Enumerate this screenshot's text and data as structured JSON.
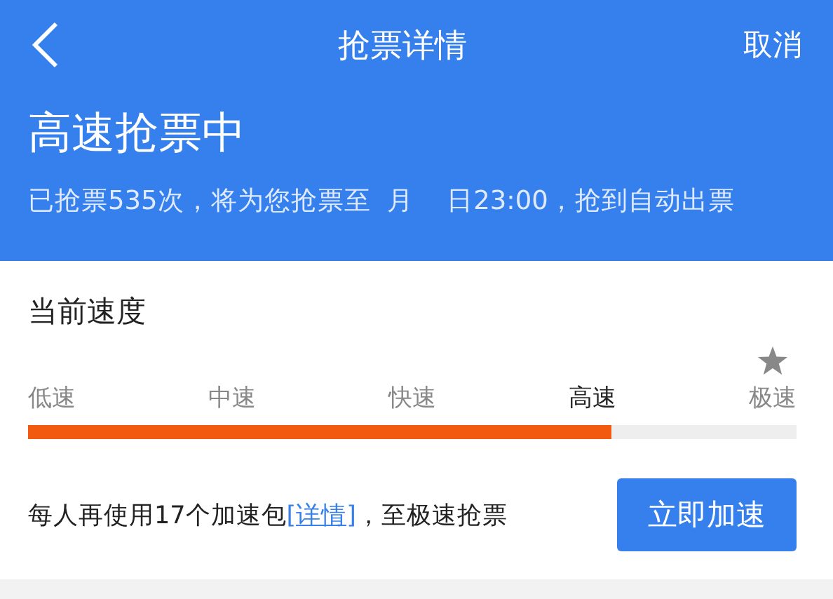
{
  "nav": {
    "title": "抢票详情",
    "cancel": "取消"
  },
  "status": {
    "title": "高速抢票中",
    "subtitle": "已抢票535次，将为您抢票至  月    日23:00，抢到自动出票"
  },
  "speed": {
    "title": "当前速度",
    "levels": [
      {
        "label": "低速",
        "selected": false
      },
      {
        "label": "中速",
        "selected": false
      },
      {
        "label": "快速",
        "selected": false
      },
      {
        "label": "高速",
        "selected": true
      },
      {
        "label": "极速",
        "selected": false
      }
    ],
    "level": 0.76
  },
  "boost": {
    "text_before": "每人再使用17个加速包",
    "link": "[详情]",
    "text_after": "，至极速抢票",
    "button": "立即加速"
  }
}
